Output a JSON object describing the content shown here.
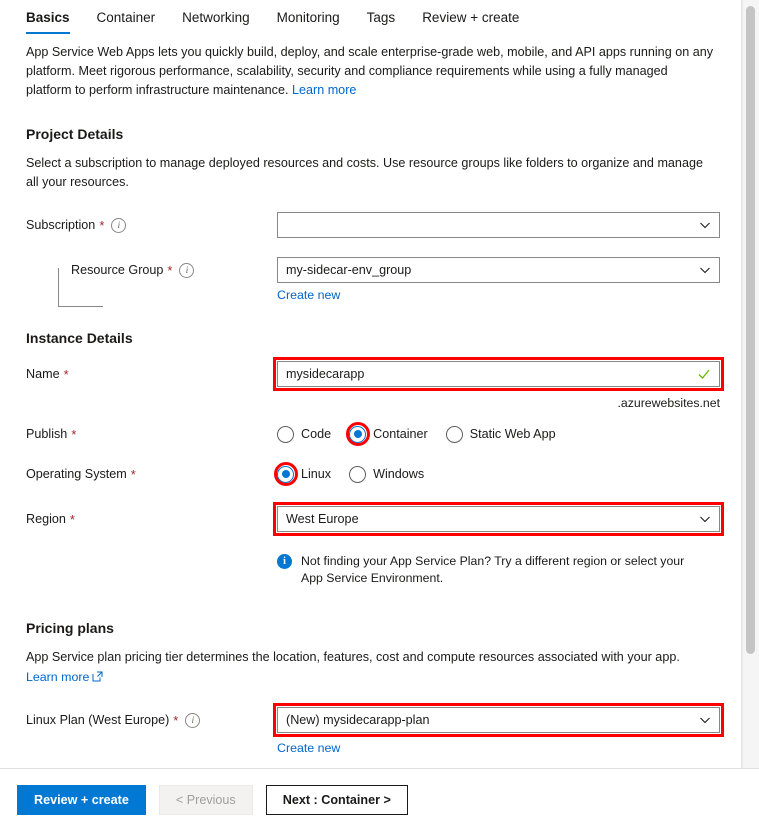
{
  "tabs": [
    {
      "label": "Basics",
      "active": true
    },
    {
      "label": "Container",
      "active": false
    },
    {
      "label": "Networking",
      "active": false
    },
    {
      "label": "Monitoring",
      "active": false
    },
    {
      "label": "Tags",
      "active": false
    },
    {
      "label": "Review + create",
      "active": false
    }
  ],
  "intro": {
    "text": "App Service Web Apps lets you quickly build, deploy, and scale enterprise-grade web, mobile, and API apps running on any platform. Meet rigorous performance, scalability, security and compliance requirements while using a fully managed platform to perform infrastructure maintenance. ",
    "learn_more": "Learn more"
  },
  "project_details": {
    "heading": "Project Details",
    "description": "Select a subscription to manage deployed resources and costs. Use resource groups like folders to organize and manage all your resources.",
    "subscription": {
      "label": "Subscription",
      "value": "",
      "placeholder": ""
    },
    "resource_group": {
      "label": "Resource Group",
      "value": "my-sidecar-env_group",
      "create_new": "Create new"
    }
  },
  "instance_details": {
    "heading": "Instance Details",
    "name": {
      "label": "Name",
      "value": "mysidecarapp",
      "suffix": ".azurewebsites.net"
    },
    "publish": {
      "label": "Publish",
      "options": [
        {
          "label": "Code",
          "selected": false
        },
        {
          "label": "Container",
          "selected": true
        },
        {
          "label": "Static Web App",
          "selected": false
        }
      ]
    },
    "operating_system": {
      "label": "Operating System",
      "options": [
        {
          "label": "Linux",
          "selected": true
        },
        {
          "label": "Windows",
          "selected": false
        }
      ]
    },
    "region": {
      "label": "Region",
      "value": "West Europe",
      "note": "Not finding your App Service Plan? Try a different region or select your App Service Environment."
    }
  },
  "pricing_plans": {
    "heading": "Pricing plans",
    "description": "App Service plan pricing tier determines the location, features, cost and compute resources associated with your app.",
    "learn_more": "Learn more",
    "linux_plan": {
      "label": "Linux Plan (West Europe)",
      "value": "(New) mysidecarapp-plan",
      "create_new": "Create new"
    }
  },
  "footer": {
    "review_create": "Review + create",
    "previous": "< Previous",
    "next": "Next : Container >"
  },
  "colors": {
    "accent": "#0078d4",
    "link": "#0066cc",
    "required": "#a4262c",
    "annotation": "#ff0000",
    "success": "#6bb700"
  }
}
